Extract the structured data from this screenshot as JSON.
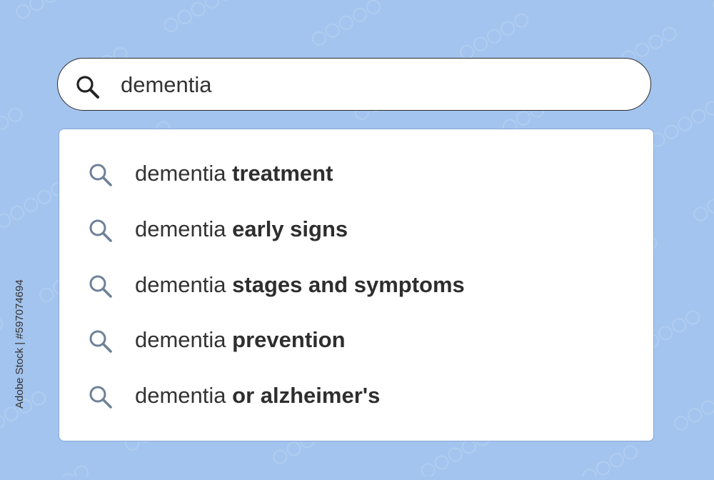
{
  "colors": {
    "background": "#a3c4ee",
    "search_border": "#2c2c2c",
    "panel_bg": "#ffffff",
    "suggestion_icon": "#6e8197",
    "text": "#333333"
  },
  "search": {
    "icon": "magnifier-icon",
    "query": "dementia"
  },
  "suggestions": [
    {
      "base": "dementia",
      "completion": "treatment",
      "icon": "magnifier-icon"
    },
    {
      "base": "dementia",
      "completion": "early signs",
      "icon": "magnifier-icon"
    },
    {
      "base": "dementia",
      "completion": "stages and symptoms",
      "icon": "magnifier-icon"
    },
    {
      "base": "dementia",
      "completion": "prevention",
      "icon": "magnifier-icon"
    },
    {
      "base": "dementia",
      "completion": "or alzheimer's",
      "icon": "magnifier-icon"
    }
  ],
  "credit": "Adobe Stock | #597074694"
}
